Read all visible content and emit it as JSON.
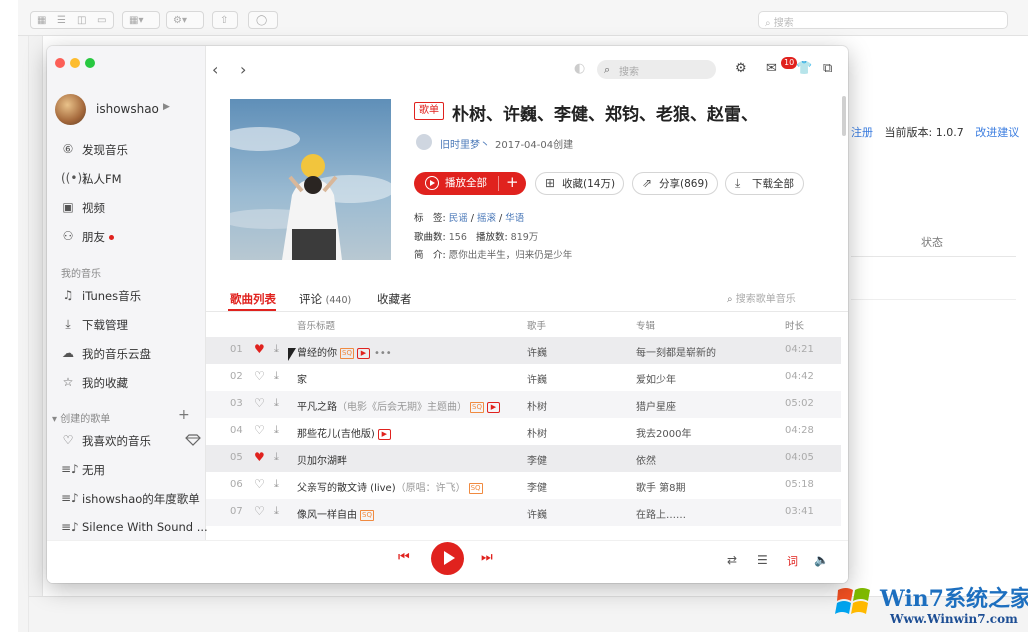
{
  "background_window": {
    "search_placeholder": "搜索",
    "links": {
      "register": "注册",
      "version": "当前版本: 1.0.7",
      "feedback": "改进建议"
    },
    "column_status": "状态"
  },
  "watermark": {
    "brand": "Win7系统之家",
    "url": "Www.Winwin7.com"
  },
  "app": {
    "user": {
      "name": "ishowshao"
    },
    "nav": [
      {
        "label": "发现音乐",
        "icon": "discover-icon"
      },
      {
        "label": "私人FM",
        "icon": "radio-icon"
      },
      {
        "label": "视频",
        "icon": "video-icon"
      },
      {
        "label": "朋友",
        "icon": "friends-icon"
      }
    ],
    "my_music_title": "我的音乐",
    "my_music": [
      {
        "label": "iTunes音乐",
        "icon": "itunes-icon"
      },
      {
        "label": "下载管理",
        "icon": "download-icon"
      },
      {
        "label": "我的音乐云盘",
        "icon": "cloud-icon"
      },
      {
        "label": "我的收藏",
        "icon": "star-icon"
      }
    ],
    "created_title": "创建的歌单",
    "created": [
      {
        "label": "我喜欢的音乐",
        "icon": "heart-icon"
      },
      {
        "label": "无用",
        "icon": "playlist-icon"
      },
      {
        "label": "ishowshao的年度歌单",
        "icon": "playlist-icon"
      },
      {
        "label": "Silence With Sound ...",
        "icon": "playlist-icon"
      }
    ],
    "search_placeholder": "搜索",
    "mail_badge": "10",
    "playlist": {
      "tag": "歌单",
      "title": "朴树、许巍、李健、郑钧、老狼、赵雷、",
      "creator": "旧时里梦丶",
      "created_date": "2017-04-04创建",
      "play_all": "播放全部",
      "collect": "收藏(14万)",
      "share": "分享(869)",
      "download_all": "下载全部",
      "tags_label": "标　签:",
      "tags": [
        "民谣",
        "摇滚",
        "华语"
      ],
      "song_count_label": "歌曲数:",
      "song_count": "156",
      "play_count_label": "播放数:",
      "play_count": "819万",
      "intro_label": "简　介:",
      "intro": "愿你出走半生，归来仍是少年"
    },
    "tabs": {
      "songs": "歌曲列表",
      "comments": "评论",
      "comments_count": "(440)",
      "collectors": "收藏者"
    },
    "table_search_placeholder": "搜索歌单音乐",
    "columns": {
      "title": "音乐标题",
      "artist": "歌手",
      "album": "专辑",
      "duration": "时长"
    },
    "songs": [
      {
        "num": "01",
        "title": "曾经的你",
        "sub": "",
        "liked": true,
        "sq": "SQ",
        "mv": true,
        "artist": "许巍",
        "album": "每一刻都是崭新的",
        "duration": "04:21"
      },
      {
        "num": "02",
        "title": "家",
        "sub": "",
        "liked": false,
        "sq": "",
        "mv": false,
        "artist": "许巍",
        "album": "爱如少年",
        "duration": "04:42"
      },
      {
        "num": "03",
        "title": "平凡之路",
        "sub": "（电影《后会无期》主题曲）",
        "liked": false,
        "sq": "SQ",
        "mv": true,
        "artist": "朴树",
        "album": "猎户星座",
        "duration": "05:02"
      },
      {
        "num": "04",
        "title": "那些花儿(吉他版)",
        "sub": "",
        "liked": false,
        "sq": "",
        "mv": true,
        "artist": "朴树",
        "album": "我去2000年",
        "duration": "04:28"
      },
      {
        "num": "05",
        "title": "贝加尔湖畔",
        "sub": "",
        "liked": true,
        "sq": "",
        "mv": false,
        "artist": "李健",
        "album": "依然",
        "duration": "04:05"
      },
      {
        "num": "06",
        "title": "父亲写的散文诗 (live)",
        "sub": "（原唱：许飞）",
        "liked": false,
        "sq": "SQ",
        "mv": false,
        "artist": "李健",
        "album": "歌手 第8期",
        "duration": "05:18"
      },
      {
        "num": "07",
        "title": "像风一样自由",
        "sub": "",
        "liked": false,
        "sq": "SQ",
        "mv": false,
        "artist": "许巍",
        "album": "在路上……",
        "duration": "03:41"
      }
    ],
    "player": {
      "lyrics_label": "词"
    }
  }
}
